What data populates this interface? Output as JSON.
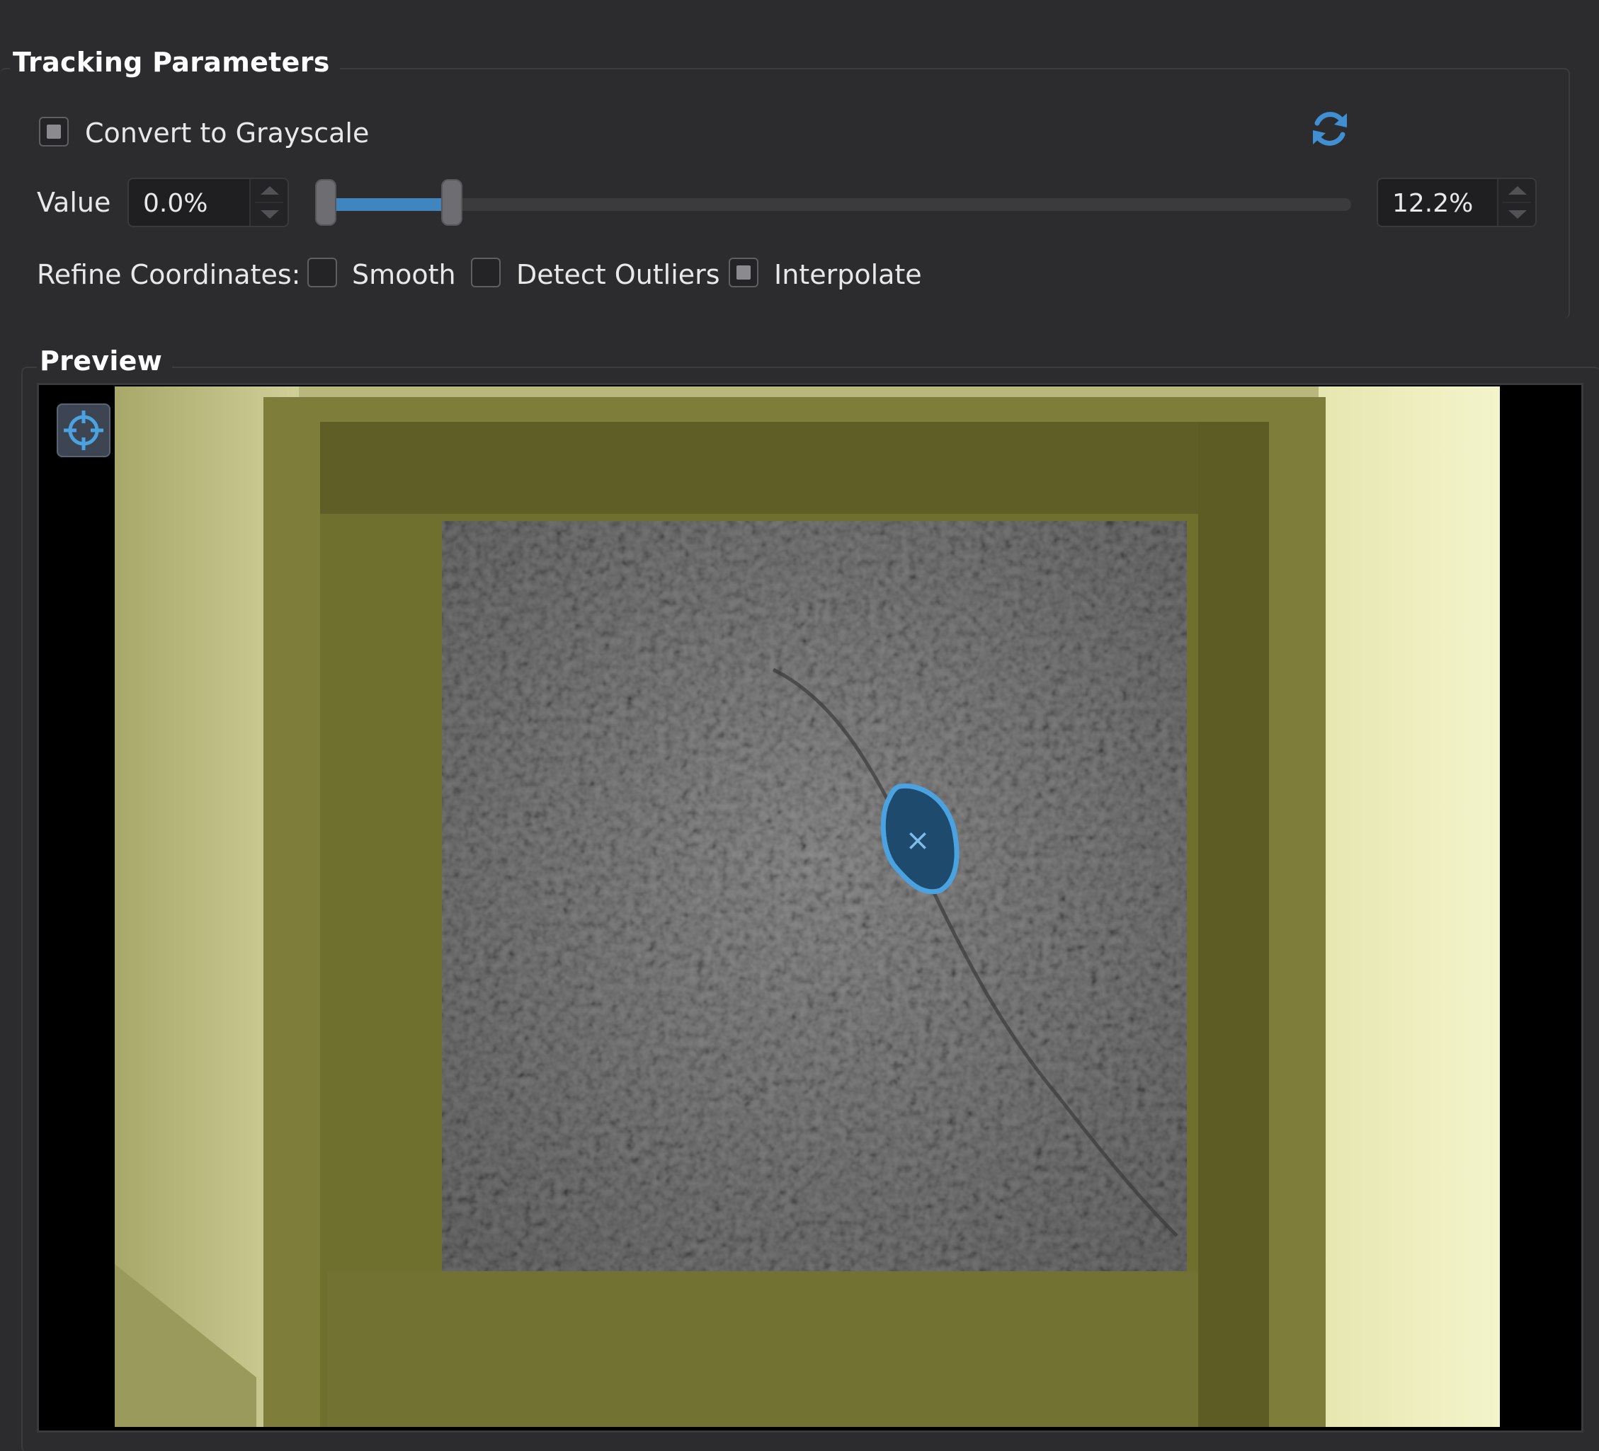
{
  "tracking": {
    "title": "Tracking Parameters",
    "grayscale_label": "Convert to Grayscale",
    "grayscale_checked": true,
    "value_label": "Value",
    "min_value": "0.0%",
    "max_value": "12.2%",
    "slider_range": [
      0.0,
      12.2
    ],
    "refine_label": "Refine Coordinates:",
    "options": [
      {
        "label": "Smooth",
        "checked": false
      },
      {
        "label": "Detect Outliers",
        "checked": false
      },
      {
        "label": "Interpolate",
        "checked": true
      }
    ]
  },
  "preview": {
    "title": "Preview",
    "marker_glyph": "×"
  },
  "colors": {
    "accent": "#3f86c0",
    "background": "#2c2c2e",
    "overlay_tint": "#c8c878",
    "blob_fill": "#1e4a6e"
  },
  "icons": {
    "refresh": "refresh-icon",
    "crosshair": "crosshair-icon"
  }
}
